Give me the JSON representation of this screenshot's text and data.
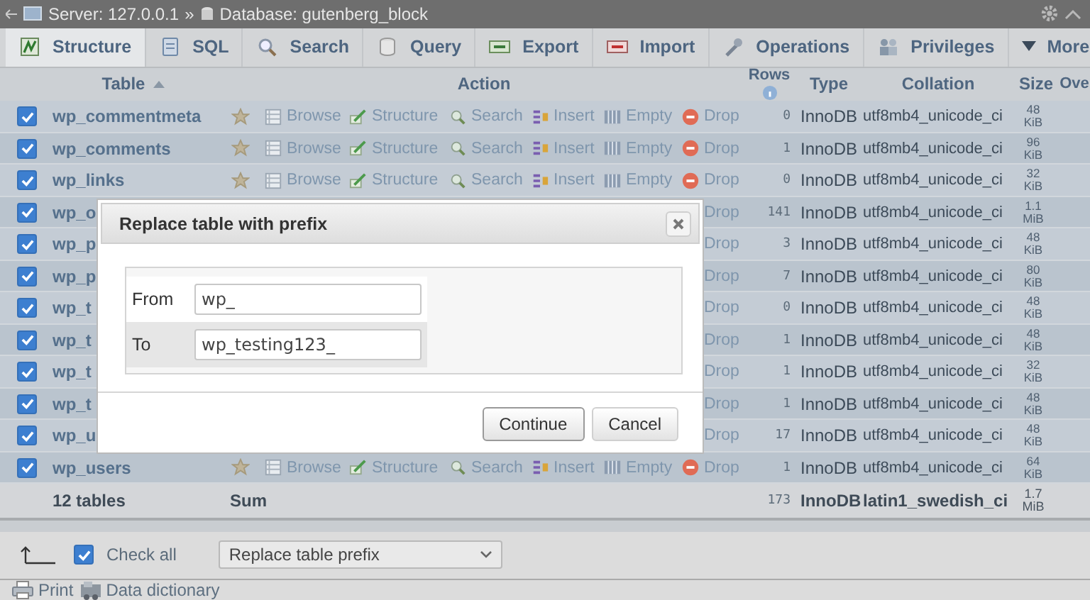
{
  "breadcrumb": {
    "server": "Server: 127.0.0.1",
    "separator": "»",
    "database": "Database: gutenberg_block"
  },
  "tabs": [
    {
      "kind": "structure",
      "label": "Structure",
      "selected": true
    },
    {
      "kind": "sql",
      "label": "SQL",
      "selected": false
    },
    {
      "kind": "search",
      "label": "Search",
      "selected": false
    },
    {
      "kind": "query",
      "label": "Query",
      "selected": false
    },
    {
      "kind": "export",
      "label": "Export",
      "selected": false
    },
    {
      "kind": "import",
      "label": "Import",
      "selected": false
    },
    {
      "kind": "operations",
      "label": "Operations",
      "selected": false
    },
    {
      "kind": "privileges",
      "label": "Privileges",
      "selected": false
    },
    {
      "kind": "more",
      "label": "More",
      "selected": false
    }
  ],
  "table": {
    "columns": [
      {
        "label": "Table",
        "sorted": true,
        "info": false
      },
      {
        "label": "Action",
        "sorted": false,
        "info": false
      },
      {
        "label": "Rows",
        "sorted": false,
        "info": true
      },
      {
        "label": "Type",
        "sorted": false,
        "info": false
      },
      {
        "label": "Collation",
        "sorted": false,
        "info": false
      },
      {
        "label": "Size",
        "sorted": false,
        "info": false
      },
      {
        "label": "Ove",
        "sorted": false,
        "info": false
      }
    ],
    "rows": [
      {
        "name": "wp_commentmeta",
        "checked": true,
        "actions": [
          {
            "kind": "favorite"
          },
          {
            "kind": "browse",
            "label": "Browse"
          },
          {
            "kind": "structure",
            "label": "Structure"
          },
          {
            "kind": "search",
            "label": "Search"
          },
          {
            "kind": "insert",
            "label": "Insert"
          },
          {
            "kind": "empty",
            "label": "Empty"
          },
          {
            "kind": "drop",
            "label": "Drop"
          }
        ],
        "rows": "0",
        "type": "InnoDB",
        "collation": "utf8mb4_unicode_ci",
        "size": "48",
        "unit": "KiB"
      },
      {
        "name": "wp_comments",
        "checked": true,
        "actions": [
          {
            "kind": "favorite"
          },
          {
            "kind": "browse",
            "label": "Browse"
          },
          {
            "kind": "structure",
            "label": "Structure"
          },
          {
            "kind": "search",
            "label": "Search"
          },
          {
            "kind": "insert",
            "label": "Insert"
          },
          {
            "kind": "empty",
            "label": "Empty"
          },
          {
            "kind": "drop",
            "label": "Drop"
          }
        ],
        "rows": "1",
        "type": "InnoDB",
        "collation": "utf8mb4_unicode_ci",
        "size": "96",
        "unit": "KiB"
      },
      {
        "name": "wp_links",
        "checked": true,
        "actions": [
          {
            "kind": "favorite"
          },
          {
            "kind": "browse",
            "label": "Browse"
          },
          {
            "kind": "structure",
            "label": "Structure"
          },
          {
            "kind": "search",
            "label": "Search"
          },
          {
            "kind": "insert",
            "label": "Insert"
          },
          {
            "kind": "empty",
            "label": "Empty"
          },
          {
            "kind": "drop",
            "label": "Drop"
          }
        ],
        "rows": "0",
        "type": "InnoDB",
        "collation": "utf8mb4_unicode_ci",
        "size": "32",
        "unit": "KiB"
      },
      {
        "name": "wp_o",
        "checked": true,
        "actions": [
          {
            "kind": "drop_text",
            "label": "Drop"
          }
        ],
        "rows": "141",
        "type": "InnoDB",
        "collation": "utf8mb4_unicode_ci",
        "size": "1.1",
        "unit": "MiB"
      },
      {
        "name": "wp_p",
        "checked": true,
        "actions": [
          {
            "kind": "drop_text",
            "label": "Drop"
          }
        ],
        "rows": "3",
        "type": "InnoDB",
        "collation": "utf8mb4_unicode_ci",
        "size": "48",
        "unit": "KiB"
      },
      {
        "name": "wp_p",
        "checked": true,
        "actions": [
          {
            "kind": "drop_text",
            "label": "Drop"
          }
        ],
        "rows": "7",
        "type": "InnoDB",
        "collation": "utf8mb4_unicode_ci",
        "size": "80",
        "unit": "KiB"
      },
      {
        "name": "wp_t",
        "checked": true,
        "actions": [
          {
            "kind": "drop_text",
            "label": "Drop"
          }
        ],
        "rows": "0",
        "type": "InnoDB",
        "collation": "utf8mb4_unicode_ci",
        "size": "48",
        "unit": "KiB"
      },
      {
        "name": "wp_t",
        "checked": true,
        "actions": [
          {
            "kind": "drop",
            "label": "Drop"
          }
        ],
        "rows": "1",
        "type": "InnoDB",
        "collation": "utf8mb4_unicode_ci",
        "size": "48",
        "unit": "KiB"
      },
      {
        "name": "wp_t",
        "checked": true,
        "actions": [
          {
            "kind": "drop",
            "label": "Drop"
          }
        ],
        "rows": "1",
        "type": "InnoDB",
        "collation": "utf8mb4_unicode_ci",
        "size": "32",
        "unit": "KiB"
      },
      {
        "name": "wp_t",
        "checked": true,
        "actions": [
          {
            "kind": "drop",
            "label": "Drop"
          }
        ],
        "rows": "1",
        "type": "InnoDB",
        "collation": "utf8mb4_unicode_ci",
        "size": "48",
        "unit": "KiB"
      },
      {
        "name": "wp_u",
        "checked": true,
        "actions": [
          {
            "kind": "drop",
            "label": "Drop"
          }
        ],
        "rows": "17",
        "type": "InnoDB",
        "collation": "utf8mb4_unicode_ci",
        "size": "48",
        "unit": "KiB"
      },
      {
        "name": "wp_users",
        "checked": true,
        "actions": [
          {
            "kind": "favorite"
          },
          {
            "kind": "browse",
            "label": "Browse"
          },
          {
            "kind": "structure",
            "label": "Structure"
          },
          {
            "kind": "search",
            "label": "Search"
          },
          {
            "kind": "insert",
            "label": "Insert"
          },
          {
            "kind": "empty",
            "label": "Empty"
          },
          {
            "kind": "drop",
            "label": "Drop"
          }
        ],
        "rows": "1",
        "type": "InnoDB",
        "collation": "utf8mb4_unicode_ci",
        "size": "64",
        "unit": "KiB"
      }
    ],
    "summary": {
      "count": "12 tables",
      "label": "Sum",
      "rows": "173",
      "type": "InnoDB",
      "collation": "latin1_swedish_ci",
      "size": "1.7",
      "unit": "MiB"
    }
  },
  "footer": {
    "check_all": {
      "label": "Check all",
      "checked": true
    },
    "bulk_action": {
      "value": "Replace table prefix"
    }
  },
  "links": [
    {
      "kind": "print",
      "label": "Print"
    },
    {
      "kind": "dictionary",
      "label": "Data dictionary"
    }
  ],
  "dialog": {
    "title": "Replace table with prefix",
    "fields": [
      {
        "label": "From",
        "value": "wp_"
      },
      {
        "label": "To",
        "value": "wp_testing123_"
      }
    ],
    "buttons": [
      "Continue",
      "Cancel"
    ]
  }
}
